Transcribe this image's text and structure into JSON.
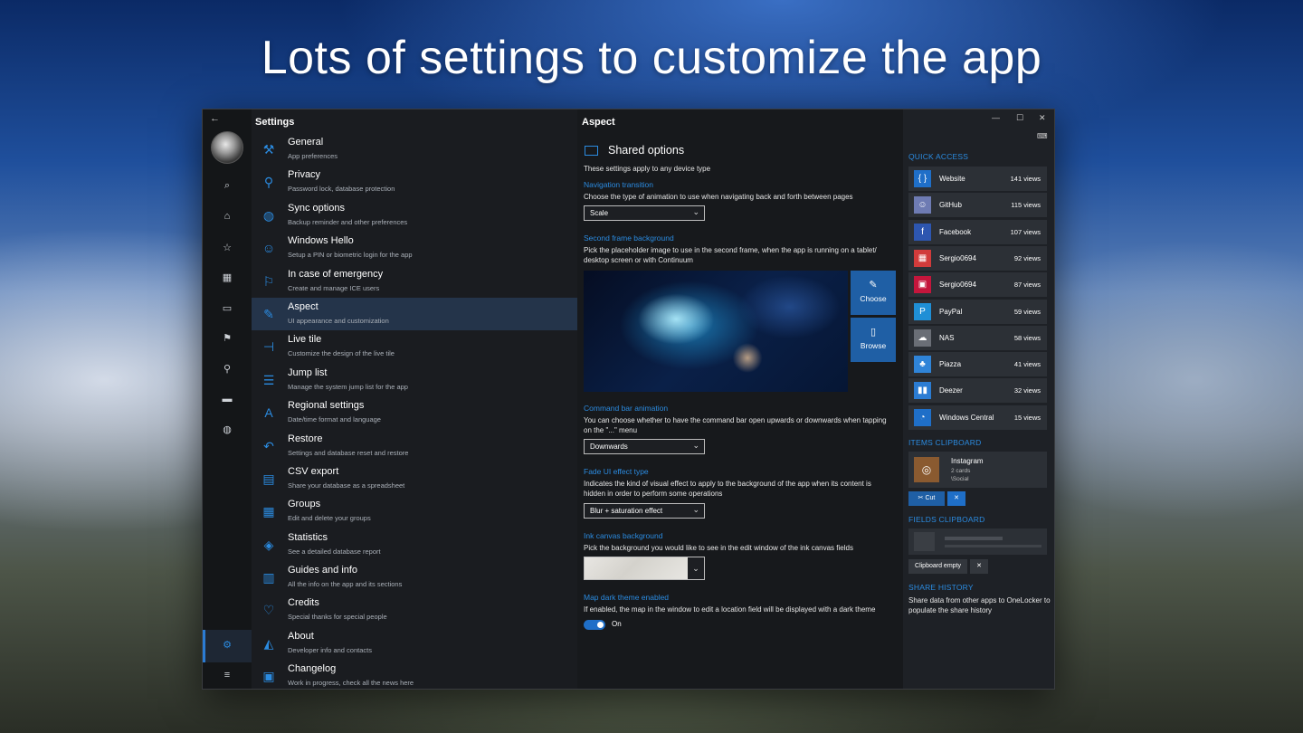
{
  "headline": "Lots of settings to customize the app",
  "window": {
    "back": "←",
    "controls": {
      "minimize": "—",
      "maximize": "☐",
      "close": "✕"
    }
  },
  "rail": {
    "icons": [
      "search-icon",
      "home-icon",
      "star-icon",
      "grid-icon",
      "card-icon",
      "flag-icon",
      "key-icon",
      "keyboard-icon",
      "globe-icon",
      "settings-icon",
      "menu-icon"
    ],
    "glyphs": {
      "search": "⌕",
      "home": "⌂",
      "star": "☆",
      "grid": "▦",
      "card": "▭",
      "flag": "⚑",
      "key": "⚲",
      "keyboard": "▬",
      "globe": "◍",
      "settings": "⚙",
      "menu": "≡"
    }
  },
  "settings": {
    "title": "Settings",
    "items": [
      {
        "title": "General",
        "subtitle": "App preferences",
        "icon": "wrench-icon",
        "glyph": "⚒"
      },
      {
        "title": "Privacy",
        "subtitle": "Password lock, database protection",
        "icon": "key-icon",
        "glyph": "⚲"
      },
      {
        "title": "Sync options",
        "subtitle": "Backup reminder and other preferences",
        "icon": "globe-icon",
        "glyph": "◍"
      },
      {
        "title": "Windows Hello",
        "subtitle": "Setup a PIN or biometric login for the app",
        "icon": "smile-icon",
        "glyph": "☺"
      },
      {
        "title": "In case of emergency",
        "subtitle": "Create and manage ICE users",
        "icon": "flag-icon",
        "glyph": "⚐"
      },
      {
        "title": "Aspect",
        "subtitle": "UI appearance and customization",
        "icon": "brush-icon",
        "glyph": "✎"
      },
      {
        "title": "Live tile",
        "subtitle": "Customize the design of the live tile",
        "icon": "pin-icon",
        "glyph": "⊣"
      },
      {
        "title": "Jump list",
        "subtitle": "Manage the system jump list for the app",
        "icon": "list-icon",
        "glyph": "☰"
      },
      {
        "title": "Regional settings",
        "subtitle": "Date/time format and language",
        "icon": "language-icon",
        "glyph": "A"
      },
      {
        "title": "Restore",
        "subtitle": "Settings and database reset and restore",
        "icon": "undo-icon",
        "glyph": "↶"
      },
      {
        "title": "CSV export",
        "subtitle": "Share your database as a spreadsheet",
        "icon": "calendar-icon",
        "glyph": "▤"
      },
      {
        "title": "Groups",
        "subtitle": "Edit and delete your groups",
        "icon": "grid-icon",
        "glyph": "▦"
      },
      {
        "title": "Statistics",
        "subtitle": "See a detailed database report",
        "icon": "layers-icon",
        "glyph": "◈"
      },
      {
        "title": "Guides and info",
        "subtitle": "All the info on the app and its sections",
        "icon": "library-icon",
        "glyph": "▥"
      },
      {
        "title": "Credits",
        "subtitle": "Special thanks for special people",
        "icon": "heart-icon",
        "glyph": "♡"
      },
      {
        "title": "About",
        "subtitle": "Developer info and contacts",
        "icon": "graduation-icon",
        "glyph": "◭"
      },
      {
        "title": "Changelog",
        "subtitle": "Work in progress, check all the news here",
        "icon": "code-icon",
        "glyph": "▣"
      }
    ]
  },
  "aspect": {
    "title": "Aspect",
    "section_title": "Shared options",
    "section_desc": "These settings apply to any device type",
    "nav_transition": {
      "heading": "Navigation transition",
      "desc": "Choose the type of animation to use when navigating back and forth between pages",
      "value": "Scale"
    },
    "second_frame": {
      "heading": "Second frame background",
      "desc1": "Pick the placeholder image to use in the second frame, when the app is running on a tablet/",
      "desc2": "desktop screen or with Continuum",
      "choose": "Choose",
      "browse": "Browse"
    },
    "command_bar": {
      "heading": "Command bar animation",
      "desc1": "You can choose whether to have the command bar open upwards or downwards when tapping",
      "desc2": "on the \"...\" menu",
      "value": "Downwards"
    },
    "fade_ui": {
      "heading": "Fade UI effect type",
      "desc1": "Indicates the kind of visual effect to apply to the background of the app when its content is",
      "desc2": "hidden in order to perform some operations",
      "value": "Blur + saturation effect"
    },
    "ink_canvas": {
      "heading": "Ink canvas background",
      "desc": "Pick the background you would like to see in the edit window of the ink canvas fields"
    },
    "map_dark": {
      "heading": "Map dark theme enabled",
      "desc": "If enabled, the map in the window to edit a location field will be displayed with a dark theme",
      "state": "On",
      "enabled": true
    }
  },
  "right_panel": {
    "quick_access_title": "QUICK ACCESS",
    "quick_access": [
      {
        "name": "Website",
        "views": "141 views",
        "color": "#1f6fc8",
        "glyph": "{ }"
      },
      {
        "name": "GitHub",
        "views": "115 views",
        "color": "#6e7bb3",
        "glyph": "☺"
      },
      {
        "name": "Facebook",
        "views": "107 views",
        "color": "#2d56b0",
        "glyph": "f"
      },
      {
        "name": "Sergio0694",
        "views": "92 views",
        "color": "#d13b3b",
        "glyph": "▦"
      },
      {
        "name": "Sergio0694",
        "views": "87 views",
        "color": "#c4163c",
        "glyph": "▣"
      },
      {
        "name": "PayPal",
        "views": "59 views",
        "color": "#1f8fd6",
        "glyph": "P"
      },
      {
        "name": "NAS",
        "views": "58 views",
        "color": "#6a6e76",
        "glyph": "☁"
      },
      {
        "name": "Piazza",
        "views": "41 views",
        "color": "#2f84d8",
        "glyph": "♣"
      },
      {
        "name": "Deezer",
        "views": "32 views",
        "color": "#2b7cd3",
        "glyph": "▮▮"
      },
      {
        "name": "Windows Central",
        "views": "15 views",
        "color": "#1f6fc8",
        "glyph": "◔"
      }
    ],
    "items_clipboard_title": "ITEMS CLIPBOARD",
    "clip_item": {
      "name": "Instagram",
      "cards": "2 cards",
      "path": "\\Social"
    },
    "cut_label": "Cut",
    "fields_clipboard_title": "FIELDS CLIPBOARD",
    "clipboard_empty": "Clipboard empty",
    "share_history_title": "SHARE HISTORY",
    "share_history_desc": "Share data from other apps to OneLocker to populate the share history"
  },
  "colors": {
    "accent": "#2b8be0",
    "button": "#1f5fa5",
    "active_item": "#24344a"
  }
}
